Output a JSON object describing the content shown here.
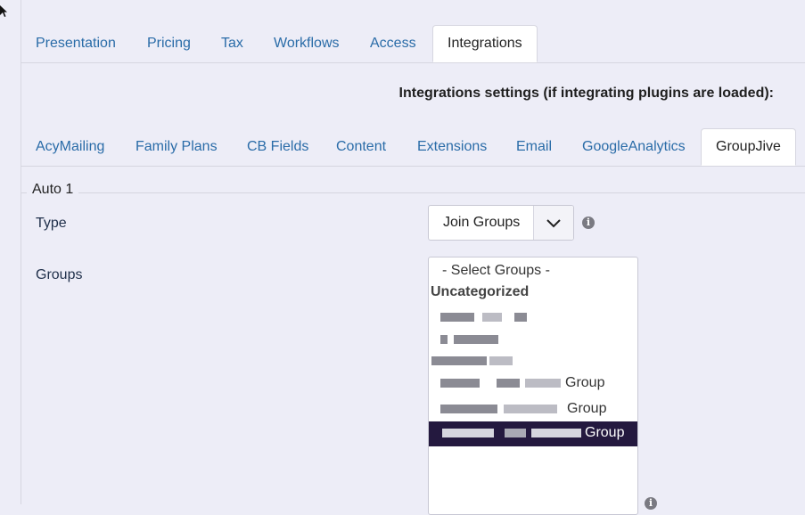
{
  "top_tabs": [
    {
      "label": "Presentation",
      "active": false
    },
    {
      "label": "Pricing",
      "active": false
    },
    {
      "label": "Tax",
      "active": false
    },
    {
      "label": "Workflows",
      "active": false
    },
    {
      "label": "Access",
      "active": false
    },
    {
      "label": "Integrations",
      "active": true
    }
  ],
  "integrations_heading": "Integrations settings (if integrating plugins are loaded):",
  "sub_tabs": [
    {
      "label": "AcyMailing",
      "active": false
    },
    {
      "label": "Family Plans",
      "active": false
    },
    {
      "label": "CB Fields",
      "active": false
    },
    {
      "label": "Content",
      "active": false
    },
    {
      "label": "Extensions",
      "active": false
    },
    {
      "label": "Email",
      "active": false
    },
    {
      "label": "GoogleAnalytics",
      "active": false
    },
    {
      "label": "GroupJive",
      "active": true
    }
  ],
  "fieldset": {
    "legend": "Auto 1",
    "type": {
      "label": "Type",
      "selected": "Join Groups",
      "icon": "chevron-down-icon"
    },
    "groups": {
      "label": "Groups",
      "placeholder_option": "- Select Groups -",
      "category": "Uncategorized",
      "options": [
        {
          "suffix": ""
        },
        {
          "suffix": ""
        },
        {
          "suffix": ""
        },
        {
          "suffix": "Group"
        },
        {
          "suffix": "Group"
        },
        {
          "suffix": "Group",
          "selected": true
        }
      ]
    }
  },
  "colors": {
    "accent_link": "#2a6ca8",
    "selected_option_bg": "#24193f",
    "page_bg": "#ededf7"
  }
}
